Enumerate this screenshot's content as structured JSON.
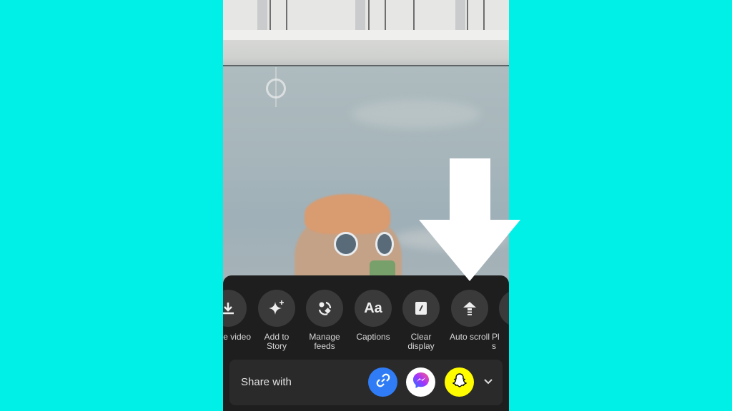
{
  "colors": {
    "background": "#00F0E8",
    "sheet": "#1e1e1e",
    "link_blue": "#2F7CF6",
    "snapchat_yellow": "#FFFC00",
    "arrow": "#FFFFFF"
  },
  "actions": [
    {
      "id": "save-video",
      "icon": "download-icon",
      "label": "Save video",
      "visible_label": "e video"
    },
    {
      "id": "add-to-story",
      "icon": "sparkle-icon",
      "label": "Add to\nStory"
    },
    {
      "id": "manage-feeds",
      "icon": "manage-feeds-icon",
      "label": "Manage\nfeeds"
    },
    {
      "id": "captions",
      "icon": "captions-icon",
      "label": "Captions",
      "glyph": "Aa"
    },
    {
      "id": "clear-display",
      "icon": "clear-display-icon",
      "label": "Clear\ndisplay"
    },
    {
      "id": "auto-scroll",
      "icon": "auto-scroll-icon",
      "label": "Auto scroll"
    },
    {
      "id": "playback-speed",
      "icon": "playback-icon",
      "label": "Pl\ns"
    }
  ],
  "share": {
    "label": "Share with",
    "targets": [
      {
        "id": "copy-link",
        "icon": "link-icon"
      },
      {
        "id": "messenger",
        "icon": "messenger-icon"
      },
      {
        "id": "snapchat",
        "icon": "snapchat-icon"
      }
    ],
    "more_icon": "chevron-down-icon"
  },
  "annotation": {
    "type": "arrow-down",
    "points_to": "Auto scroll"
  }
}
